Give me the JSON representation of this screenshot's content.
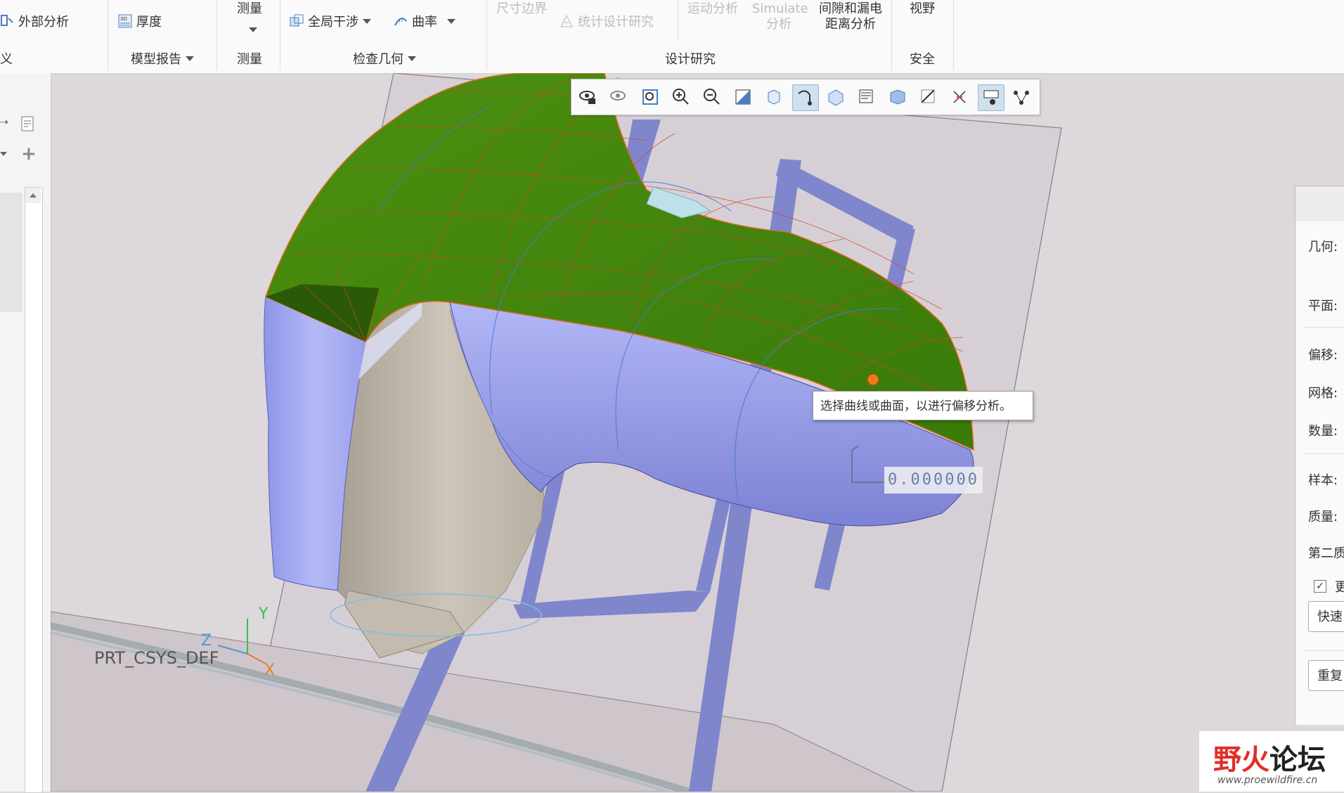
{
  "ribbon": {
    "items": {
      "external_analysis": "外部分析",
      "thickness": "厚度",
      "measure": "测量",
      "global_interference": "全局干涉",
      "curvature": "曲率",
      "dimension_boundary": "尺寸边界",
      "statistical_design": "统计设计研究",
      "motion_analysis": "运动分析",
      "simulate_line1": "Simulate",
      "simulate_line2": "分析",
      "clearance_line1": "间隙和漏电",
      "clearance_line2": "距离分析",
      "view": "视野"
    },
    "groups": {
      "custom_partial": "义",
      "model_report": "模型报告",
      "measure": "测量",
      "inspect_geometry": "检查几何",
      "design_study": "设计研究",
      "safety": "安全"
    }
  },
  "viewport": {
    "tooltip": "选择曲线或曲面，以进行偏移分析。",
    "measure_value": "0.000000",
    "csys_label": "PRT_CSYS_DEF",
    "axis_x": "X",
    "axis_y": "Y",
    "axis_z": "Z"
  },
  "right_panel": {
    "geometry": "几何:",
    "plane": "平面:",
    "offset": "偏移:",
    "mesh": "网格:",
    "count": "数量:",
    "sample": "样本:",
    "quality": "质量:",
    "second_quality": "第二质",
    "checkbox_label": "更",
    "quick_button": "快速",
    "repeat_button": "重复"
  },
  "watermark": {
    "title_a": "野火",
    "title_b": "论坛",
    "url": "www.proewildfire.cn"
  },
  "colors": {
    "accent_green": "#3f8a0c",
    "surface_blue": "#a8aef2",
    "frame_blue": "#7f86cc",
    "curvature_red": "#d0432a",
    "watermark_red": "#e0302a"
  }
}
